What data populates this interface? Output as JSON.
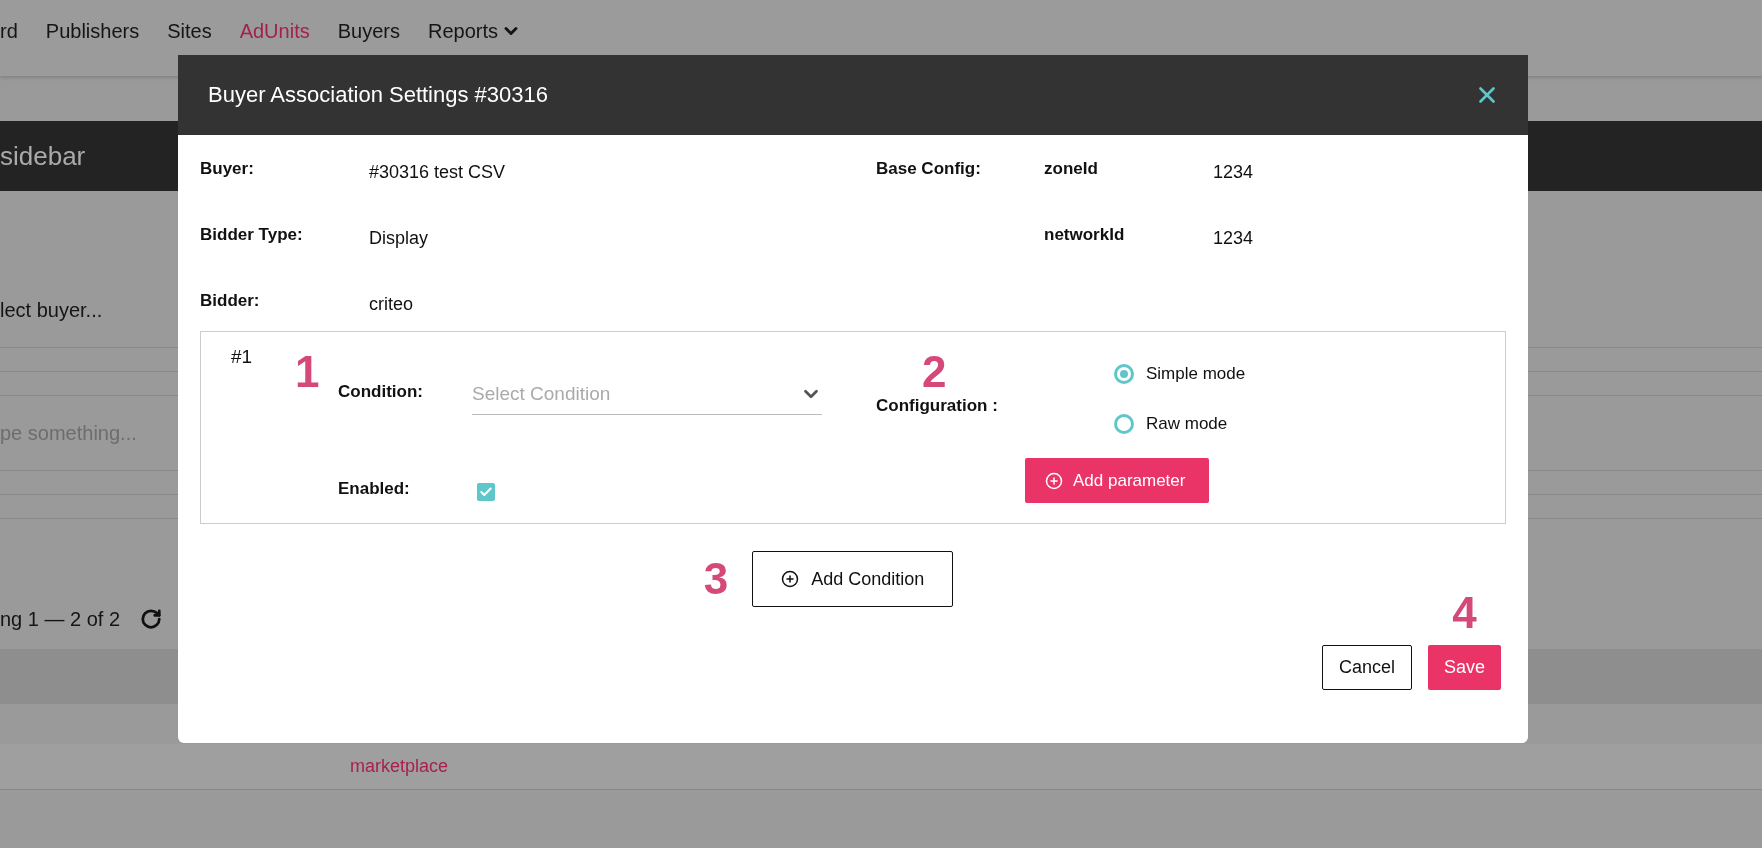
{
  "nav": {
    "items": [
      {
        "label": "rd",
        "selected": false,
        "dropdown": false
      },
      {
        "label": "Publishers",
        "selected": false,
        "dropdown": false
      },
      {
        "label": "Sites",
        "selected": false,
        "dropdown": false
      },
      {
        "label": "AdUnits",
        "selected": true,
        "dropdown": false
      },
      {
        "label": "Buyers",
        "selected": false,
        "dropdown": false
      },
      {
        "label": "Reports",
        "selected": false,
        "dropdown": true
      }
    ]
  },
  "page": {
    "header_title": "sidebar",
    "buyer_select": {
      "value": "lect buyer..."
    },
    "search": {
      "placeholder": "pe something..."
    },
    "pagination": {
      "text": "ng 1 — 2 of 2"
    },
    "table": {
      "rows": [
        {
          "cells": [
            "marketplace"
          ]
        }
      ]
    }
  },
  "modal": {
    "title": "Buyer Association Settings #30316",
    "fields": [
      {
        "label": "Buyer:",
        "value": "#30316 test CSV"
      },
      {
        "label": "Bidder Type:",
        "value": "Display"
      },
      {
        "label": "Bidder:",
        "value": "criteo"
      }
    ],
    "base_config": {
      "label": "Base Config:",
      "params": [
        {
          "name": "zoneId",
          "value": "1234"
        },
        {
          "name": "networkId",
          "value": "1234"
        }
      ]
    },
    "conditions": [
      {
        "number": "#1",
        "marker": "1",
        "condition_label": "Condition:",
        "condition_select": {
          "placeholder": "Select Condition"
        },
        "enabled_label": "Enabled:",
        "enabled": true,
        "config_marker": "2",
        "config_label": "Configuration :",
        "modes": [
          {
            "label": "Simple mode",
            "selected": true
          },
          {
            "label": "Raw mode",
            "selected": false
          }
        ],
        "add_parameter": "Add parameter"
      }
    ],
    "add_condition": {
      "marker": "3",
      "label": "Add Condition"
    },
    "footer": {
      "marker": "4",
      "buttons": [
        {
          "label": "Cancel",
          "kind": "secondary"
        },
        {
          "label": "Save",
          "kind": "primary"
        }
      ]
    }
  }
}
